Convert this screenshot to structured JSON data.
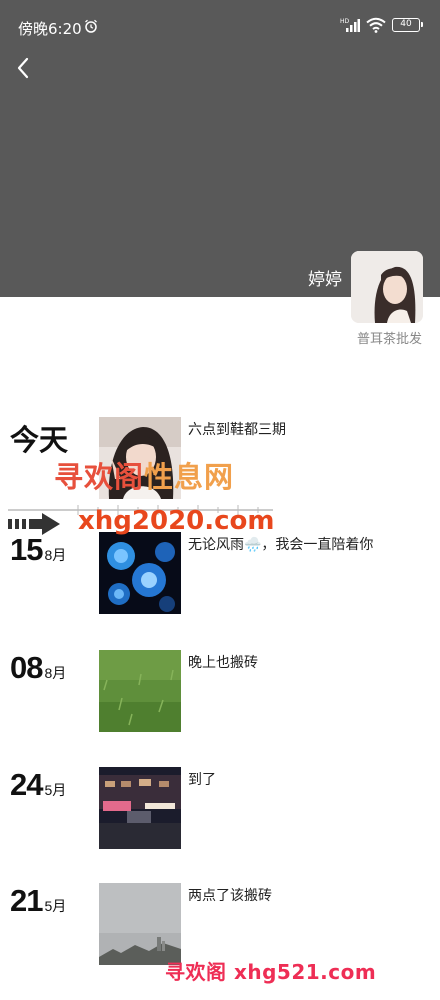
{
  "status_bar": {
    "time": "傍晚6:20",
    "signal_label": "HD",
    "battery": "40"
  },
  "profile": {
    "nickname": "婷婷",
    "signature": "普耳茶批发"
  },
  "icons": {
    "back": "chevron-left-icon",
    "alarm": "alarm-clock-icon",
    "signal": "cellular-signal-icon",
    "wifi": "wifi-icon",
    "battery": "battery-icon"
  },
  "posts": [
    {
      "date_label": "今天",
      "day": "",
      "month": "",
      "text": "六点到鞋都三期",
      "thumb": "selfie-photo"
    },
    {
      "date_label": "",
      "day": "15",
      "month": "8月",
      "text": "无论风雨🌧️，我会一直陪着你",
      "thumb": "blue-roses-photo"
    },
    {
      "date_label": "",
      "day": "08",
      "month": "8月",
      "text": "晚上也搬砖",
      "thumb": "grass-photo"
    },
    {
      "date_label": "",
      "day": "24",
      "month": "5月",
      "text": "到了",
      "thumb": "night-street-photo"
    },
    {
      "date_label": "",
      "day": "21",
      "month": "5月",
      "text": "两点了该搬砖",
      "thumb": "cloudy-sky-photo"
    }
  ],
  "watermarks": {
    "top_title_a": "寻欢阁",
    "top_title_b": "性息网",
    "top_url": "xhg2020.com",
    "bottom": "寻欢阁 xhg521.com"
  },
  "colors": {
    "cover": "#595959",
    "watermark_red": "#e7503c",
    "watermark_orange": "#f1a04c",
    "watermark_pink": "#ee2e55"
  }
}
